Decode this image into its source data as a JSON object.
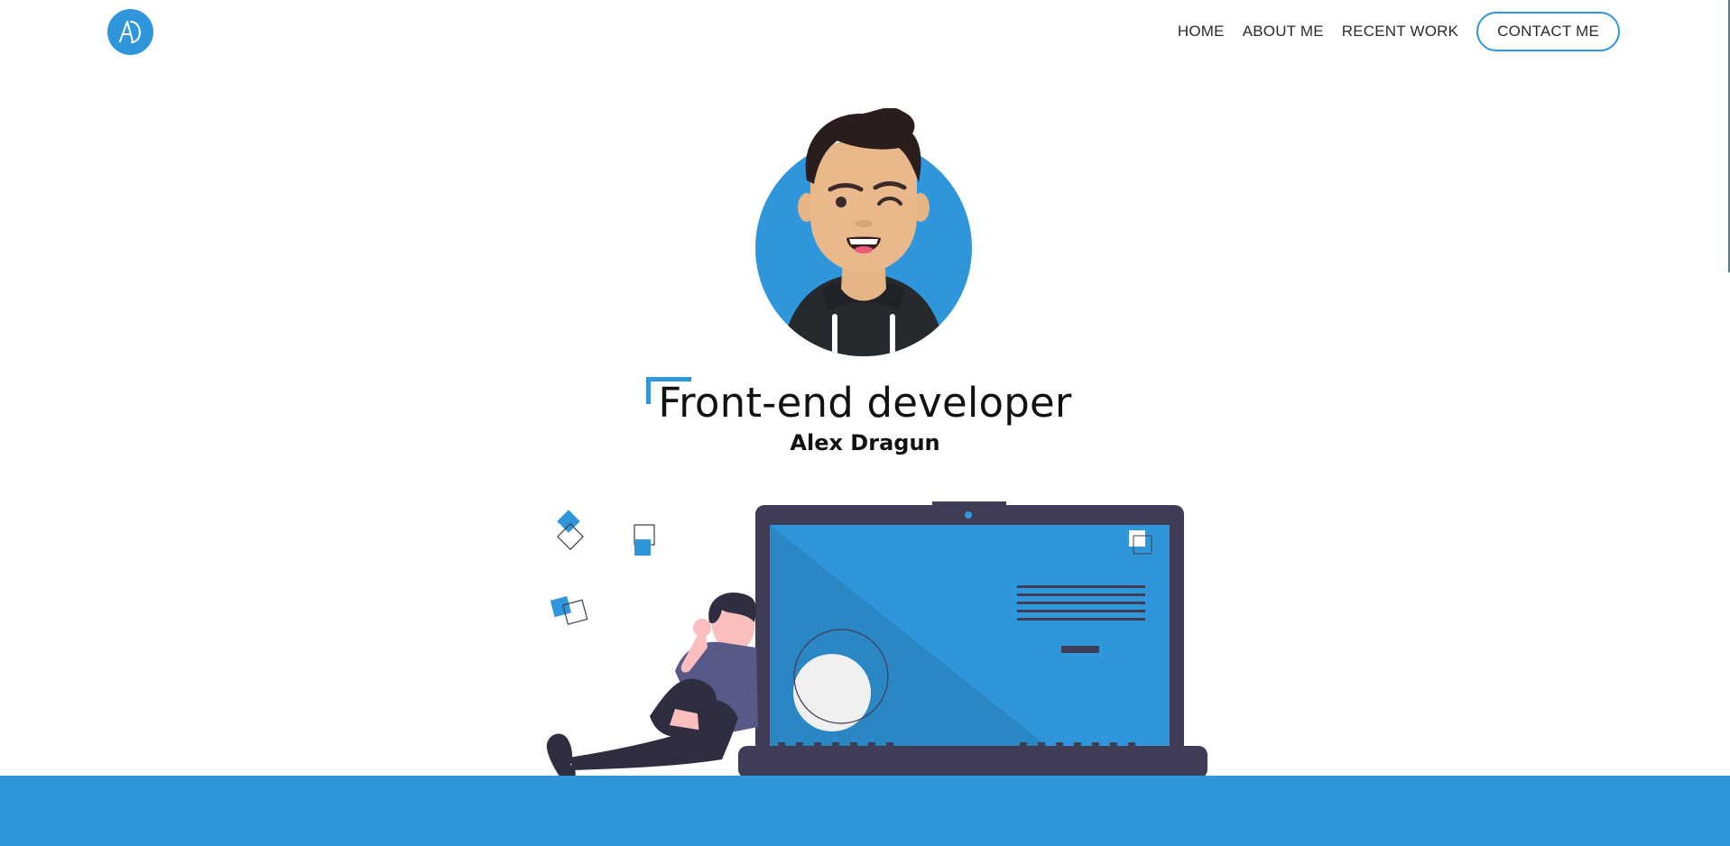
{
  "header": {
    "logo_initials": "AD",
    "nav": [
      {
        "label": "HOME"
      },
      {
        "label": "ABOUT ME"
      },
      {
        "label": "RECENT WORK"
      }
    ],
    "cta_label": "CONTACT ME"
  },
  "hero": {
    "title": "Front-end developer",
    "subtitle": "Alex Dragun"
  },
  "icons": {
    "logo": "ad-logo-icon",
    "avatar": "developer-avatar",
    "illustration": "person-laptop-illustration"
  },
  "colors": {
    "accent": "#3096db",
    "laptop_frame": "#3f3d56",
    "background": "#ffffff"
  }
}
